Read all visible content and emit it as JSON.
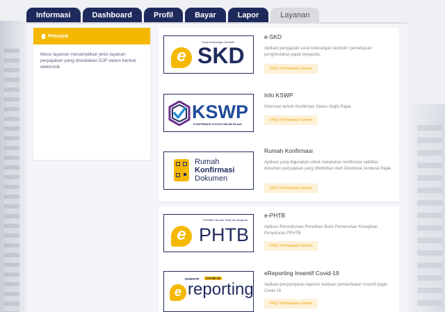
{
  "tabs": [
    {
      "label": "Informasi",
      "active": false
    },
    {
      "label": "Dashboard",
      "active": false
    },
    {
      "label": "Profil",
      "active": false
    },
    {
      "label": "Bayar",
      "active": false
    },
    {
      "label": "Lapor",
      "active": false
    },
    {
      "label": "Layanan",
      "active": true
    }
  ],
  "sidebar": {
    "title": "Petunjuk",
    "text": "Menu layanan menampilkan jenis layanan perpajakan yang disediakan DJP dalam bentuk elektronik"
  },
  "services": [
    {
      "title": "e-SKD",
      "desc": "Aplikasi pengajuan surat keterangan domisili / persetujuan penghindaran pajak berganda.",
      "faq": "FAQ / Pertanyaan Umum",
      "logo": {
        "big": "SKD",
        "small": "Surat Keterangan Domisili",
        "e": "e"
      }
    },
    {
      "title": "Info KSWP",
      "desc": "Informasi terkait Konfirmasi Status Wajib Pajak.",
      "faq": "FAQ / Pertanyaan Umum",
      "logo": {
        "big": "KSWP",
        "small": "KONFIRMASI STATUS WAJIB PAJAK"
      }
    },
    {
      "title": "Rumah Konfirmasi",
      "desc": "Aplikasi yang digunakan untuk melakukan konfirmasi validitas dokumen perpajakan yang diterbitkan oleh Direktorat Jenderal Pajak.",
      "faq": "FAQ / Pertanyaan Umum",
      "logo": {
        "line1": "Rumah",
        "line2": "Konfirmasi",
        "line3": "Dokumen"
      }
    },
    {
      "title": "e-PHTB",
      "desc": "Aplikasi Permohonan Penelitian Bukti Pemenuhan Kewajiban Penyetoran PPHTB",
      "faq": "FAQ / Pertanyaan Umum",
      "logo": {
        "big": "PHTB",
        "small": "Penelitian Hak atas Tanah dan Bangunan",
        "e": "e"
      }
    },
    {
      "title": "eReporting Insentif Covid-19",
      "desc": "Aplikasi penyampaian laporan realisasi pemanfaatan insentif pajak Covid-19.",
      "faq": "FAQ / Pertanyaan Umum",
      "logo": {
        "big": "reporting",
        "small": "INSENTIF",
        "badge": "COVID-19",
        "e": "e"
      }
    }
  ],
  "colors": {
    "navy": "#1f2a5c",
    "accent": "#f5b800",
    "faq_text": "#f0a500",
    "faq_bg": "#fdf1d8"
  }
}
